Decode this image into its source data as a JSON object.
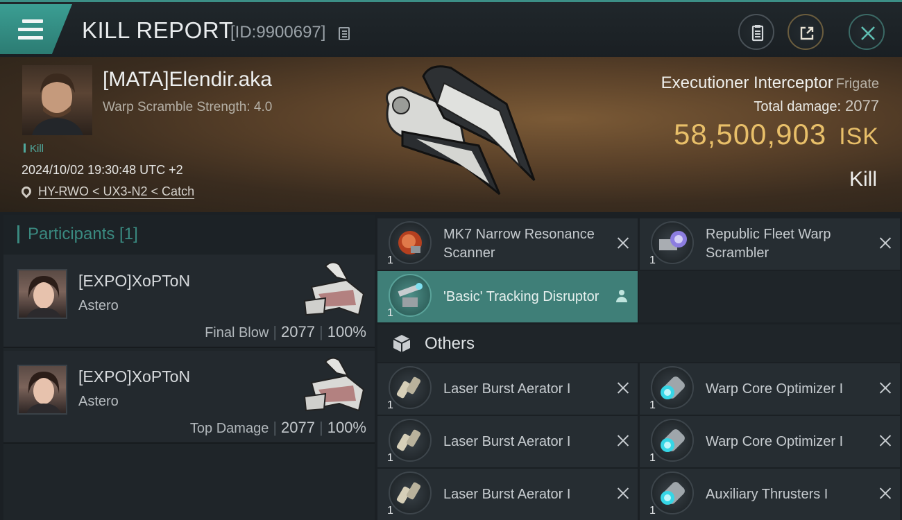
{
  "header": {
    "title": "KILL REPORT",
    "report_id": "[ID:9900697]"
  },
  "victim": {
    "name": "[MATA]Elendir.aka",
    "warp_scramble": "Warp Scramble Strength: 4.0",
    "tag": "Kill",
    "time": "2024/10/02 19:30:48 UTC +2",
    "location": "HY-RWO < UX3-N2 < Catch",
    "ship_name": "Executioner Interceptor",
    "ship_class": "Frigate",
    "total_damage_label": "Total damage:",
    "total_damage": "2077",
    "isk_value": "58,500,903",
    "isk_unit": "ISK",
    "result": "Kill"
  },
  "participants": {
    "header": "Participants [1]",
    "list": [
      {
        "name": "[EXPO]XoPToN",
        "ship": "Astero",
        "label": "Final Blow",
        "damage": "2077",
        "percent": "100%"
      },
      {
        "name": "[EXPO]XoPToN",
        "ship": "Astero",
        "label": "Top Damage",
        "damage": "2077",
        "percent": "100%"
      }
    ]
  },
  "modules": {
    "fitted": [
      {
        "name": "MK7 Narrow Resonance Scanner",
        "qty": "1",
        "icon": "scanner-icon"
      },
      {
        "name": "Republic Fleet Warp Scrambler",
        "qty": "1",
        "icon": "warp-scrambler-icon"
      },
      {
        "name": "'Basic' Tracking Disruptor",
        "qty": "1",
        "icon": "tracking-disruptor-icon"
      }
    ],
    "others_label": "Others",
    "others": [
      {
        "name": "Laser Burst Aerator I",
        "qty": "1",
        "icon": "laser-aerator-icon"
      },
      {
        "name": "Warp Core Optimizer I",
        "qty": "1",
        "icon": "warp-core-optimizer-icon"
      },
      {
        "name": "Laser Burst Aerator I",
        "qty": "1",
        "icon": "laser-aerator-icon"
      },
      {
        "name": "Warp Core Optimizer I",
        "qty": "1",
        "icon": "warp-core-optimizer-icon"
      },
      {
        "name": "Laser Burst Aerator I",
        "qty": "1",
        "icon": "laser-aerator-icon"
      },
      {
        "name": "Auxiliary Thrusters I",
        "qty": "1",
        "icon": "auxiliary-thrusters-icon"
      }
    ]
  },
  "colors": {
    "accent": "#3c8f86",
    "isk": "#e8bf69",
    "active_row": "#3f7f78"
  }
}
